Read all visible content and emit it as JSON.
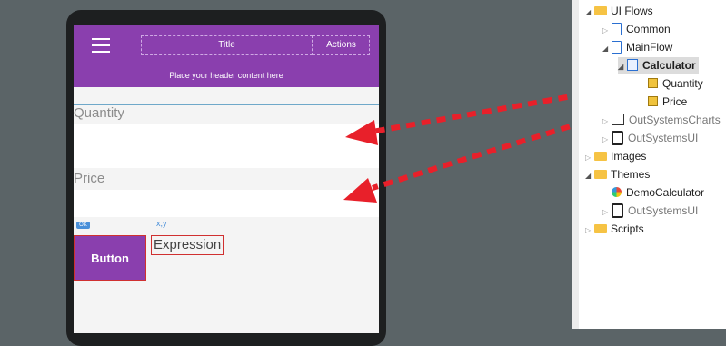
{
  "app": {
    "header": {
      "title": "Title",
      "actions": "Actions",
      "placeholder": "Place your header content here"
    },
    "form": {
      "quantity_label": "Quantity",
      "price_label": "Price",
      "ok_badge": "OK",
      "xy_label": "x,y",
      "button_label": "Button",
      "expression_label": "Expression"
    }
  },
  "tree": {
    "items": [
      {
        "label": "UI Flows"
      },
      {
        "label": "Common"
      },
      {
        "label": "MainFlow"
      },
      {
        "label": "Calculator"
      },
      {
        "label": "Quantity"
      },
      {
        "label": "Price"
      },
      {
        "label": "OutSystemsCharts"
      },
      {
        "label": "OutSystemsUI"
      },
      {
        "label": "Images"
      },
      {
        "label": "Themes"
      },
      {
        "label": "DemoCalculator"
      },
      {
        "label": "OutSystemsUI"
      },
      {
        "label": "Scripts"
      }
    ]
  },
  "colors": {
    "accent_purple": "#8a3fae",
    "arrow_red": "#e8202a",
    "canvas_bg": "#5b6467"
  }
}
